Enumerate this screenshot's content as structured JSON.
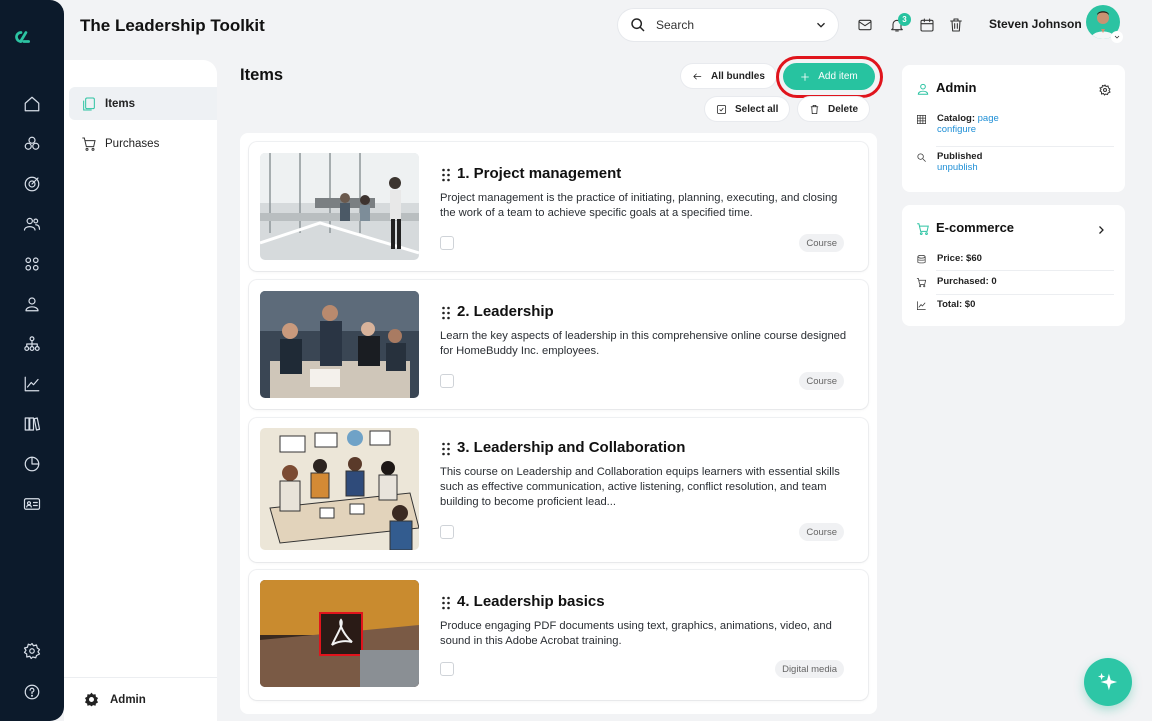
{
  "app": {
    "title": "The Leadership Toolkit"
  },
  "header": {
    "search_placeholder": "Search",
    "notification_count": "3",
    "user_name": "Steven Johnson"
  },
  "rail": {
    "icons": [
      "home-icon",
      "courses-icon",
      "target-icon",
      "users-icon",
      "apps-icon",
      "profile-icon",
      "org-chart-icon",
      "analytics-icon",
      "library-icon",
      "reports-icon",
      "id-card-icon",
      "settings-icon",
      "help-icon"
    ]
  },
  "subnav": {
    "items": [
      {
        "label": "Items",
        "icon": "items-icon",
        "active": true
      },
      {
        "label": "Purchases",
        "icon": "cart-icon",
        "active": false
      }
    ],
    "footer_label": "Admin"
  },
  "main": {
    "title": "Items",
    "all_bundles_label": "All bundles",
    "add_item_label": "Add item",
    "select_all_label": "Select all",
    "delete_label": "Delete",
    "items": [
      {
        "title": "1. Project management",
        "description": "Project management is the practice of initiating, planning, executing, and closing the work of a team to achieve specific goals at a specified time.",
        "tag": "Course"
      },
      {
        "title": "2. Leadership",
        "description": "Learn the key aspects of leadership in this comprehensive online course designed for HomeBuddy Inc. employees.",
        "tag": "Course"
      },
      {
        "title": "3. Leadership and Collaboration",
        "description": "This course on Leadership and Collaboration equips learners with essential skills such as effective communication, active listening, conflict resolution, and team building to become proficient lead...",
        "tag": "Course"
      },
      {
        "title": "4. Leadership basics",
        "description": "Produce engaging PDF documents using text, graphics, animations, video, and sound in this Adobe Acrobat training.",
        "tag": "Digital media"
      }
    ]
  },
  "admin_panel": {
    "title": "Admin",
    "catalog_label": "Catalog:",
    "catalog_link1": "page",
    "catalog_link2": "configure",
    "published_label": "Published",
    "published_link": "unpublish"
  },
  "ecommerce_panel": {
    "title": "E-commerce",
    "price": "Price: $60",
    "purchased": "Purchased: 0",
    "total": "Total: $0"
  },
  "colors": {
    "accent": "#27c3a0",
    "rail": "#0c1a2b",
    "highlight": "#e0141c",
    "link": "#1f8fd6"
  }
}
